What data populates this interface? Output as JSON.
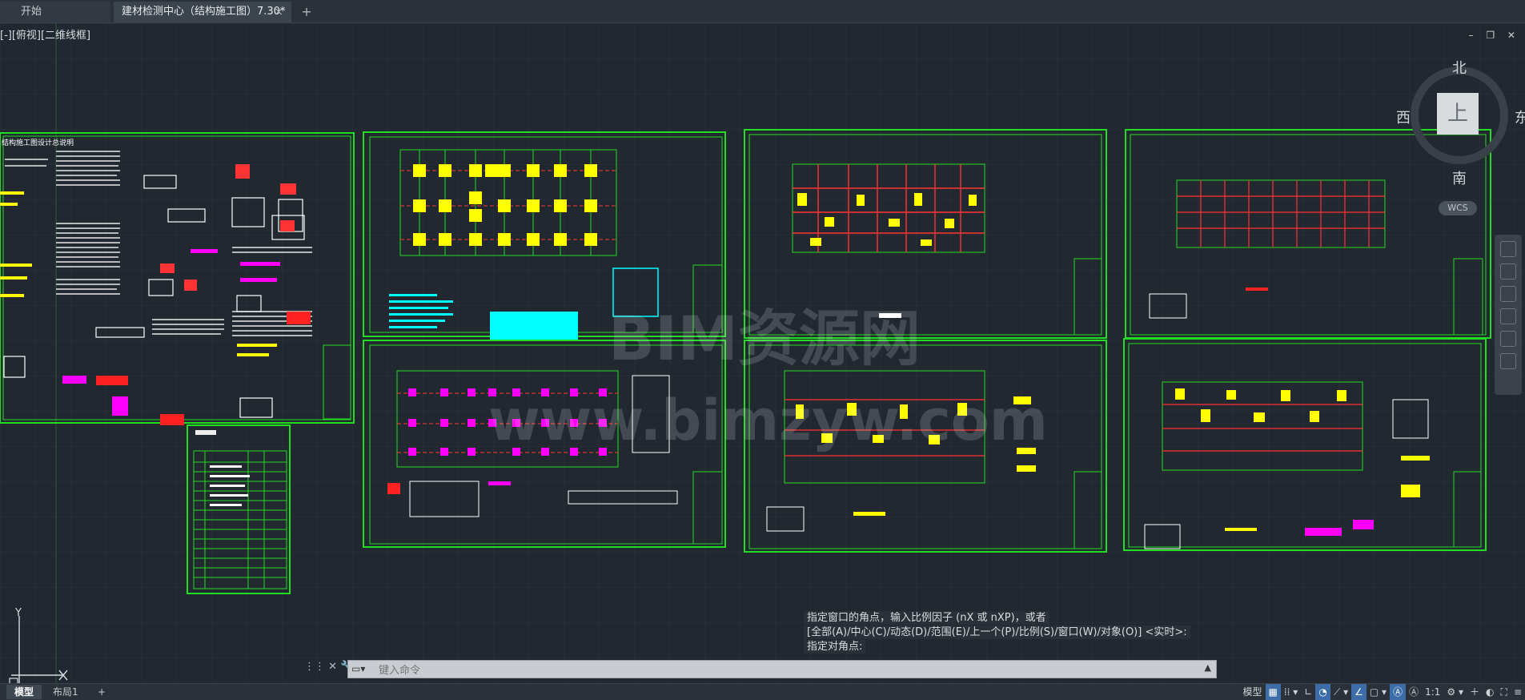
{
  "tabs": {
    "start_label": "开始",
    "active_label": "建材检测中心（结构施工图）7.30*",
    "close_symbol": "×",
    "add_symbol": "+"
  },
  "viewport": {
    "view_label": "[-][俯视][二维线框]",
    "window_controls": "– ❐ ✕",
    "watermark_line1": "BIM资源网",
    "watermark_line2": "www.bimzyw.com",
    "sheet_title_text": "结构施工图设计总说明"
  },
  "viewcube": {
    "north": "北",
    "south": "南",
    "east": "东",
    "west": "西",
    "face": "上",
    "wcs": "WCS"
  },
  "ucs": {
    "x": "X",
    "y": "Y"
  },
  "command": {
    "history": [
      "指定窗口的角点，输入比例因子 (nX 或 nXP)，或者",
      "[全部(A)/中心(C)/动态(D)/范围(E)/上一个(P)/比例(S)/窗口(W)/对象(O)] <实时>:",
      "指定对角点:"
    ],
    "placeholder": "键入命令"
  },
  "statusbar": {
    "layout_tabs": [
      "模型",
      "布局1"
    ],
    "add_layout": "+",
    "model_label": "模型",
    "scale": "1:1"
  },
  "colors": {
    "background": "#212830",
    "sheet_border": "#22dd22",
    "accent_yellow": "#ffff00",
    "accent_magenta": "#ff00ff",
    "accent_cyan": "#00ffff",
    "accent_red": "#ff2222"
  }
}
